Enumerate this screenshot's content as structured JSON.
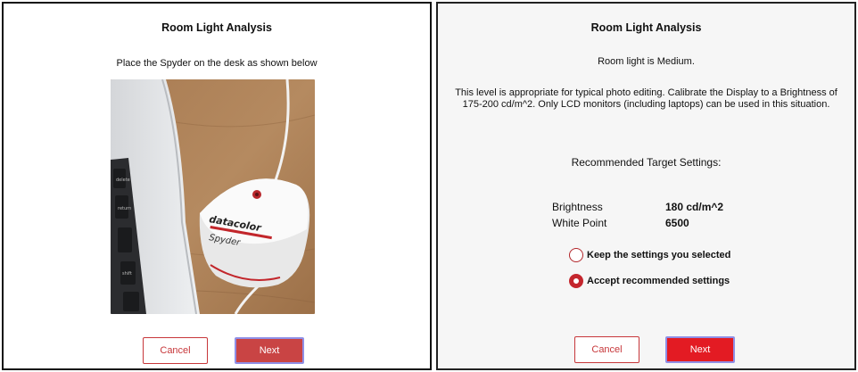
{
  "left": {
    "title": "Room Light Analysis",
    "instruction": "Place the Spyder on the desk as shown below",
    "device_brand": "datacolor",
    "device_name": "Spyder",
    "key_labels": [
      "delete",
      "return",
      "shift"
    ],
    "cancel_label": "Cancel",
    "next_label": "Next"
  },
  "right": {
    "title": "Room Light Analysis",
    "status": "Room light is Medium.",
    "description_line1": "This level is appropriate for typical photo editing. Calibrate the Display to a Brightness of",
    "description_line2": "175-200 cd/m^2. Only LCD monitors (including laptops) can be used in this situation.",
    "recommended_heading": "Recommended Target Settings:",
    "settings": [
      {
        "label": "Brightness",
        "value": "180 cd/m^2"
      },
      {
        "label": "White Point",
        "value": "6500"
      }
    ],
    "options": [
      {
        "label": "Keep the settings you selected",
        "selected": false
      },
      {
        "label": "Accept recommended settings",
        "selected": true
      }
    ],
    "cancel_label": "Cancel",
    "next_label": "Next"
  },
  "colors": {
    "accent": "#e31b23",
    "next_left": "#c94444",
    "button_focus_border": "#8f8fe6"
  }
}
